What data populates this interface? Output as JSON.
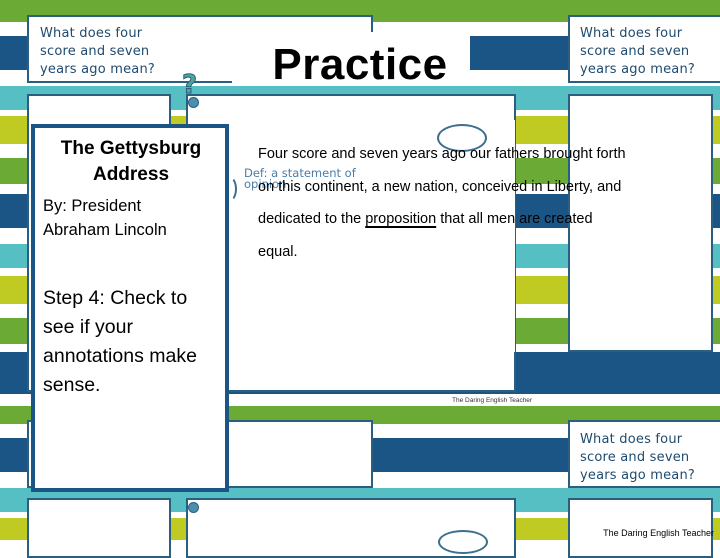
{
  "slide": {
    "title": "Practice",
    "background_tile": {
      "prompt_text": "What does four score and seven years ago mean?",
      "prompt_lines": [
        "What does four",
        "score and seven",
        "years ago mean?"
      ],
      "question_mark": "?",
      "watermark": "The Daring English Teacher"
    },
    "colors": {
      "green": "#6aaa35",
      "dark_blue": "#1b5585",
      "teal": "#56bfc4",
      "yellow_green": "#bfca22",
      "box_border": "#2a5f7f",
      "handwriting": "#1f4a6e"
    }
  },
  "info_box": {
    "title_line1": "The Gettysburg",
    "title_line2": "Address",
    "author_line1": "By: President",
    "author_line2": "Abraham Lincoln",
    "step_line1": "Step 4: Check to",
    "step_line2": "see if your",
    "step_line3": "annotations make",
    "step_line4": "sense."
  },
  "passage": {
    "line1": "Four score and seven years ago our fathers brought forth",
    "line2": "on this continent, a new nation, conceived in Liberty, and",
    "line3_before": "dedicated to the ",
    "line3_underlined": "proposition",
    "line3_after": " that all men are created",
    "line4": "equal."
  },
  "annotation": {
    "definition_line1": "Def: a statement of",
    "definition_line2": "opinion"
  },
  "footer": {
    "credit": "The Daring English Teacher"
  }
}
